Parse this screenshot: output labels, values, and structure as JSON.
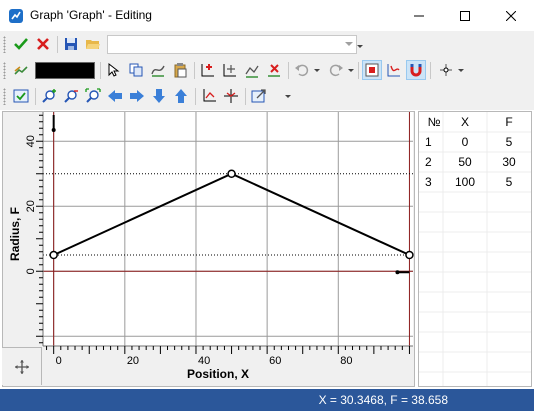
{
  "window": {
    "title": "Graph 'Graph' - Editing"
  },
  "toolbar": {
    "row1": [
      "accept-icon",
      "cancel-icon",
      "save-icon",
      "open-folder-icon",
      "combo"
    ],
    "row2": [
      "pen-tool-icon",
      "color-swatch",
      "select-arrow-icon",
      "copy-icon",
      "smooth-icon",
      "paste-icon",
      "add-point-icon",
      "move-point-icon",
      "edit-point-icon",
      "delete-point-icon",
      "undo-icon",
      "redo-icon",
      "snap-grid-icon",
      "snap-point-icon",
      "magnet-icon",
      "point-menu-icon"
    ],
    "row3": [
      "properties-icon",
      "zoom-in-icon",
      "zoom-out-icon",
      "zoom-fit-icon",
      "arrow-left-icon",
      "arrow-right-icon",
      "arrow-down-icon",
      "arrow-up-icon",
      "axes-icon",
      "center-icon",
      "export-icon"
    ],
    "combo_value": ""
  },
  "chart_data": {
    "type": "line",
    "x": [
      0,
      50,
      100
    ],
    "y": [
      5,
      30,
      5
    ],
    "xlabel": "Position, X",
    "ylabel": "Radius, F",
    "xlim": [
      -3,
      101
    ],
    "ylim": [
      -23,
      49
    ],
    "x_ticks": [
      0,
      20,
      40,
      60,
      80
    ],
    "y_ticks": [
      0,
      20,
      40
    ],
    "grid": true,
    "line_color": "#000000",
    "boundary_color": "#8b1a1a"
  },
  "table": {
    "headers": [
      "№",
      "X",
      "F"
    ],
    "rows": [
      [
        "1",
        "0",
        "5"
      ],
      [
        "2",
        "50",
        "30"
      ],
      [
        "3",
        "100",
        "5"
      ]
    ]
  },
  "status": {
    "text": "X = 30.3468, F = 38.658"
  }
}
